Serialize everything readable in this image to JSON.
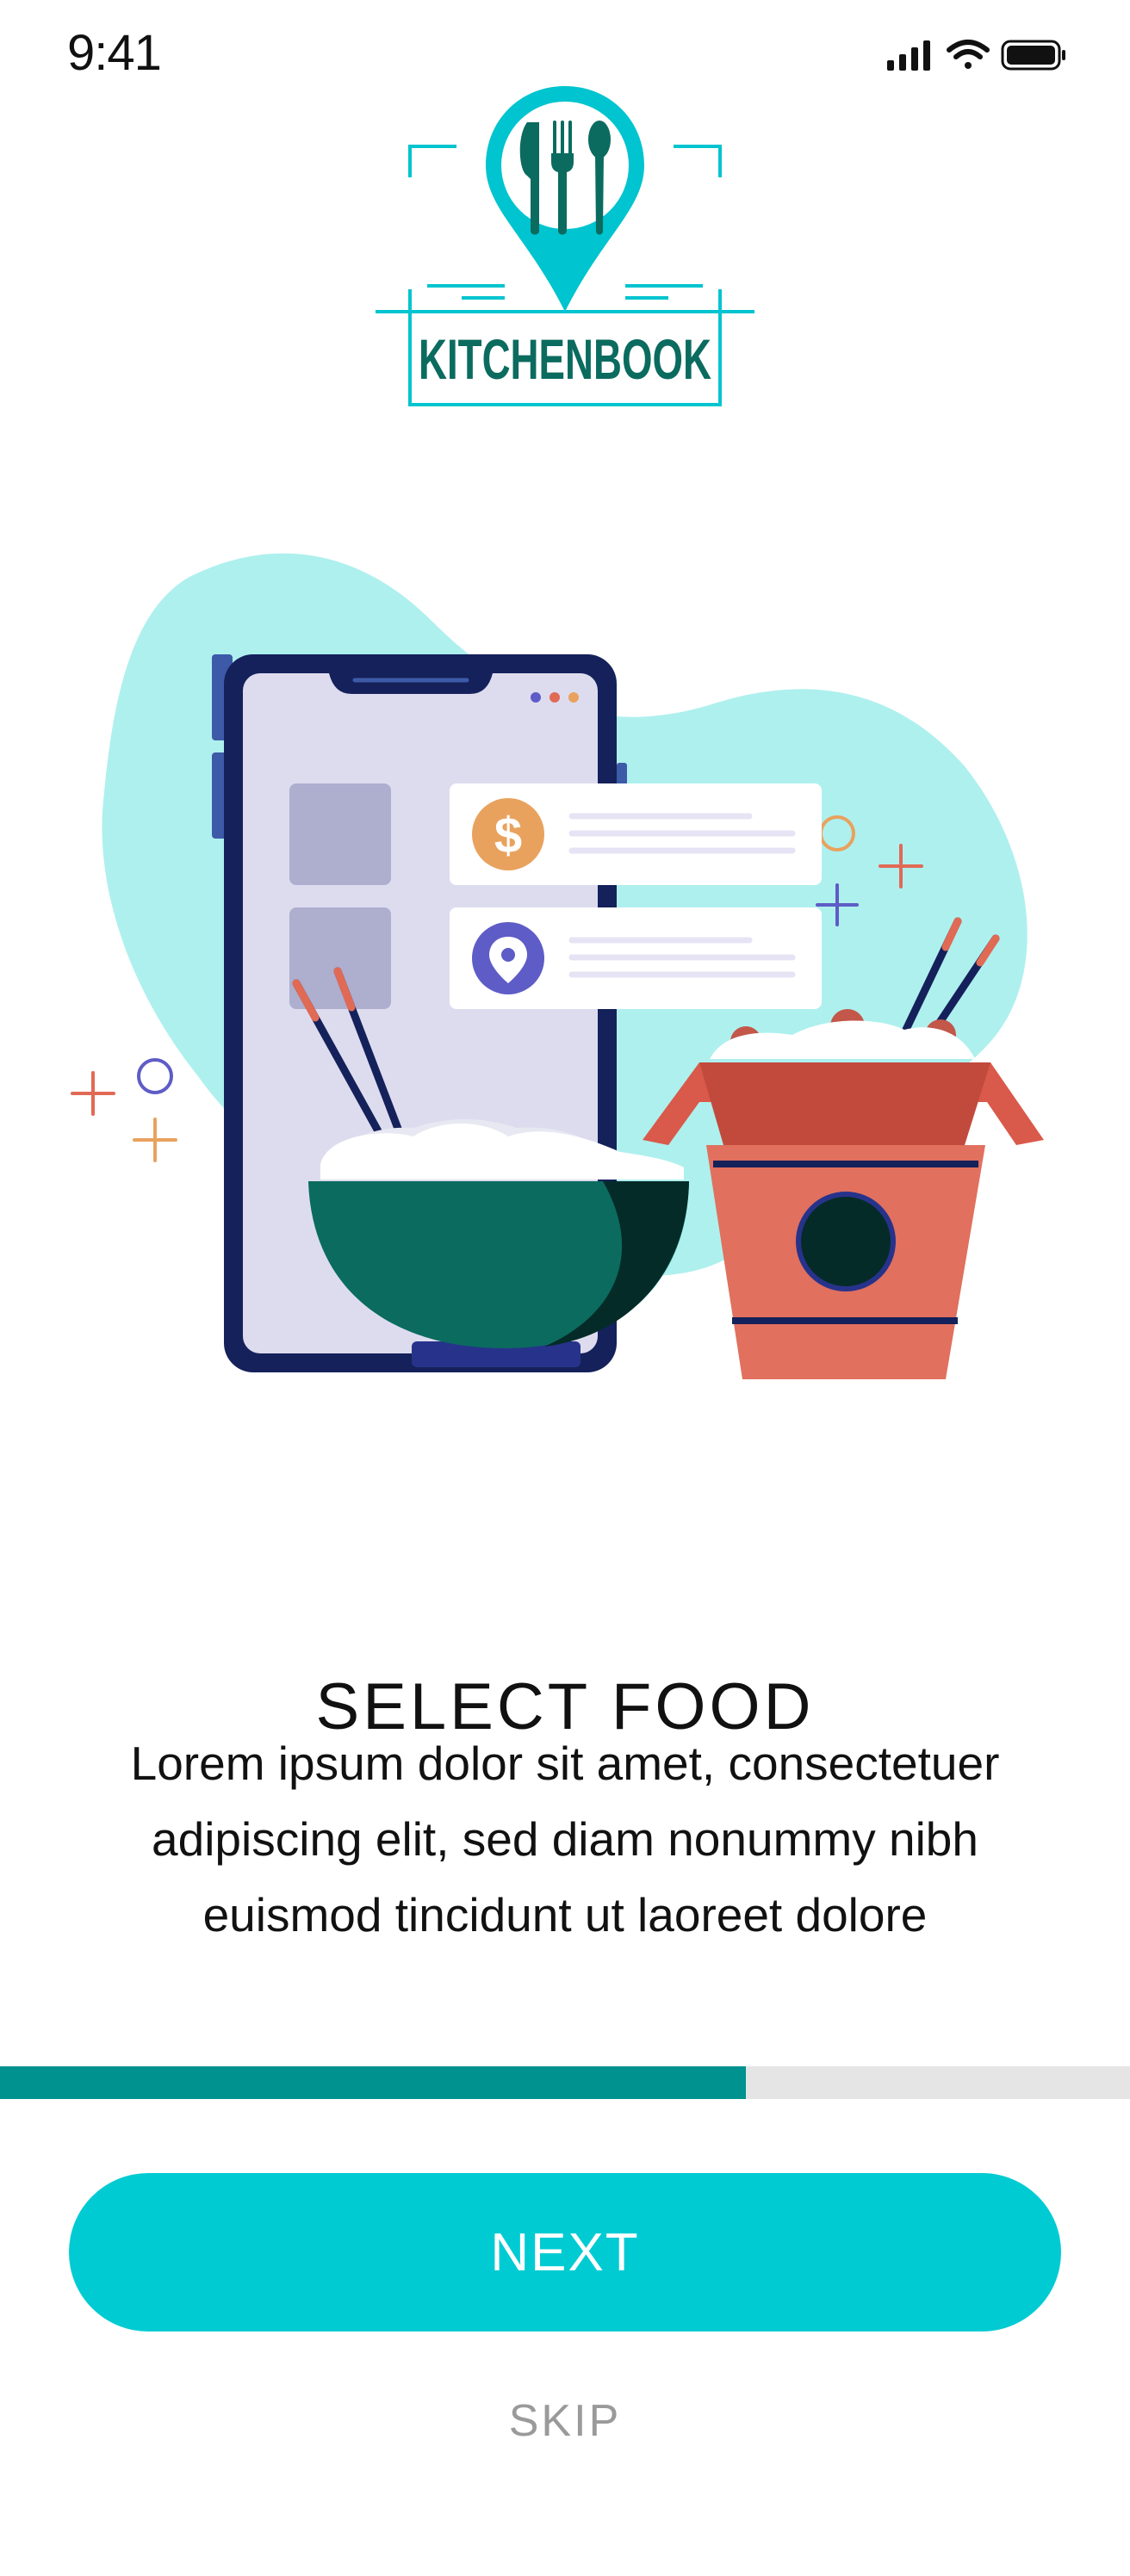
{
  "status_bar": {
    "time": "9:41",
    "icons": [
      "cellular-signal-icon",
      "wifi-icon",
      "battery-icon"
    ]
  },
  "logo": {
    "text": "KITCHENBOOK",
    "icon": "fork-knife-spoon-pin-icon"
  },
  "onboarding": {
    "title": "SELECT FOOD",
    "description_lines": [
      "Lorem ipsum dolor sit amet, consectetuer",
      "adipiscing elit, sed diam nonummy nibh",
      "euismod tincidunt ut laoreet dolore"
    ]
  },
  "progress": {
    "fraction": 0.66
  },
  "actions": {
    "next_label": "NEXT",
    "skip_label": "SKIP"
  },
  "colors": {
    "accent": "#00cbd3",
    "progress_fill": "#00928f",
    "progress_track": "#e5e5e5",
    "brand_dark": "#0b6b5f"
  }
}
